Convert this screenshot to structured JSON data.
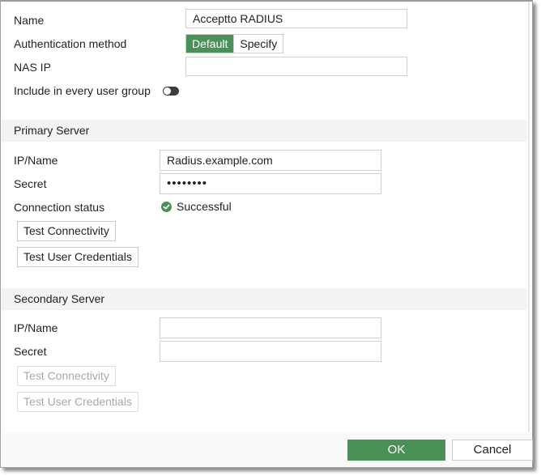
{
  "general": {
    "name_label": "Name",
    "name_value": "Acceptto RADIUS",
    "auth_method_label": "Authentication method",
    "auth_method_options": [
      "Default",
      "Specify"
    ],
    "auth_method_selected": "Default",
    "nas_ip_label": "NAS IP",
    "nas_ip_value": "",
    "include_label": "Include in every user group",
    "include_enabled": false
  },
  "primary": {
    "header": "Primary Server",
    "ip_label": "IP/Name",
    "ip_value": "Radius.example.com",
    "secret_label": "Secret",
    "secret_value": "••••••••",
    "status_label": "Connection status",
    "status_value": "Successful",
    "status_icon": "check-circle-icon",
    "test_connectivity": "Test Connectivity",
    "test_credentials": "Test User Credentials"
  },
  "secondary": {
    "header": "Secondary Server",
    "ip_label": "IP/Name",
    "ip_value": "",
    "secret_label": "Secret",
    "secret_value": "",
    "test_connectivity": "Test Connectivity",
    "test_credentials": "Test User Credentials"
  },
  "footer": {
    "ok_label": "OK",
    "cancel_label": "Cancel"
  },
  "colors": {
    "accent": "#4a9158",
    "section_bg": "#f3f3f3"
  }
}
